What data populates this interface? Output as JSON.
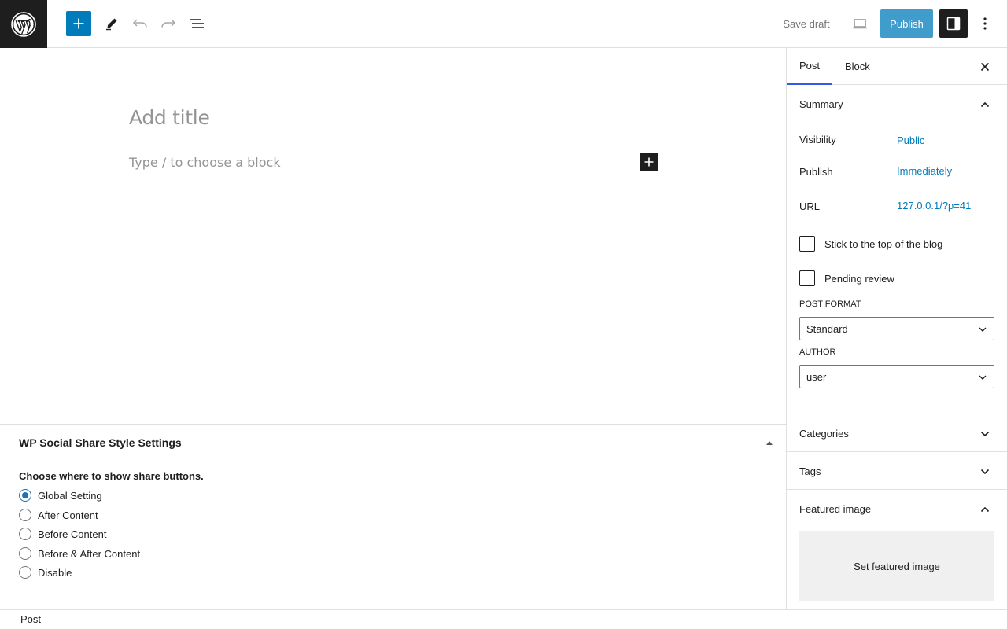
{
  "toolbar": {
    "save_draft": "Save draft",
    "publish": "Publish"
  },
  "editor": {
    "title_placeholder": "Add title",
    "block_placeholder": "Type / to choose a block"
  },
  "metabox": {
    "title": "WP Social Share Style Settings",
    "question": "Choose where to show share buttons.",
    "options": [
      {
        "label": "Global Setting",
        "checked": true
      },
      {
        "label": "After Content",
        "checked": false
      },
      {
        "label": "Before Content",
        "checked": false
      },
      {
        "label": "Before & After Content",
        "checked": false
      },
      {
        "label": "Disable",
        "checked": false
      }
    ]
  },
  "footer": {
    "breadcrumb": "Post"
  },
  "sidebar": {
    "tabs": [
      {
        "label": "Post",
        "active": true
      },
      {
        "label": "Block",
        "active": false
      }
    ],
    "summary": {
      "title": "Summary",
      "visibility_label": "Visibility",
      "visibility_value": "Public",
      "publish_label": "Publish",
      "publish_value": "Immediately",
      "url_label": "URL",
      "url_value": "127.0.0.1/?p=41",
      "sticky_label": "Stick to the top of the blog",
      "pending_label": "Pending review",
      "post_format_label": "POST FORMAT",
      "post_format_value": "Standard",
      "author_label": "AUTHOR",
      "author_value": "user"
    },
    "categories": "Categories",
    "tags": "Tags",
    "featured_image": {
      "title": "Featured image",
      "button": "Set featured image"
    }
  },
  "colors": {
    "accent": "#007cba",
    "dark": "#1e1e1e",
    "tab_indicator": "#3858e9",
    "radio_checked": "#2271b1"
  },
  "icons": [
    "wordpress-logo-icon",
    "plus-icon",
    "pencil-icon",
    "undo-icon",
    "redo-icon",
    "list-view-icon",
    "desktop-preview-icon",
    "sidebar-toggle-icon",
    "more-options-icon",
    "close-icon",
    "chevron-up-icon",
    "chevron-down-icon",
    "triangle-up-icon"
  ]
}
